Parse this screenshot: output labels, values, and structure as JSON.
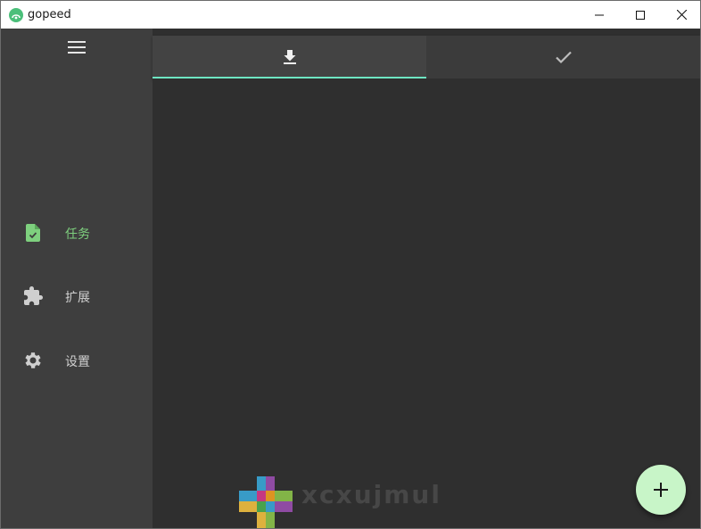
{
  "window": {
    "title": "gopeed",
    "controls": [
      "minimize",
      "maximize",
      "close"
    ]
  },
  "sidebar": {
    "menu_icon": "hamburger-menu-icon",
    "items": [
      {
        "label": "任务",
        "icon": "task-file-icon",
        "active": true
      },
      {
        "label": "扩展",
        "icon": "puzzle-icon",
        "active": false
      },
      {
        "label": "设置",
        "icon": "gear-icon",
        "active": false
      }
    ]
  },
  "tabs": [
    {
      "icon": "download-icon",
      "active": true
    },
    {
      "icon": "check-icon",
      "active": false
    }
  ],
  "fab": {
    "icon": "plus-icon"
  },
  "watermark": {
    "text": "xcxujmul"
  },
  "colors": {
    "accent": "#6ee6c2",
    "active_nav": "#7ed07e",
    "fab": "#c8f5c8",
    "sidebar": "#3e3e3e",
    "content": "#2f2f2f"
  }
}
